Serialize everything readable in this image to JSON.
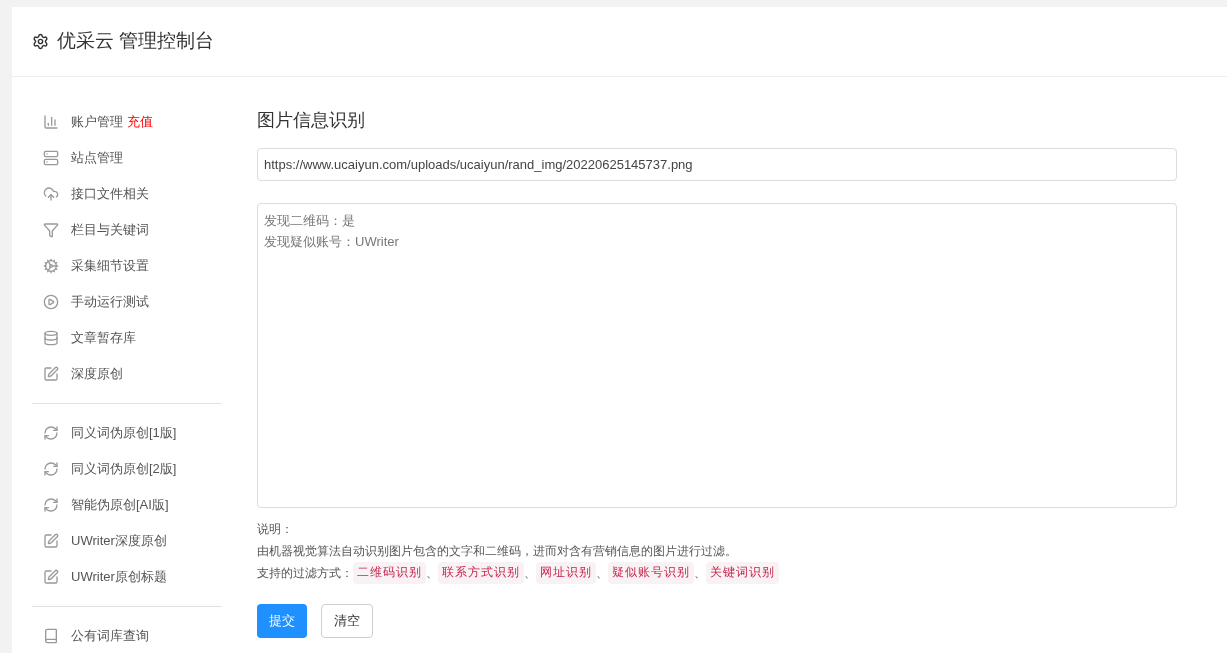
{
  "header": {
    "title": "优采云 管理控制台"
  },
  "sidebar": {
    "items": [
      {
        "kind": "chart",
        "label": "账户管理",
        "badge": "充值"
      },
      {
        "kind": "server",
        "label": "站点管理"
      },
      {
        "kind": "cloud",
        "label": "接口文件相关"
      },
      {
        "kind": "filter",
        "label": "栏目与关键词"
      },
      {
        "kind": "gears",
        "label": "采集细节设置"
      },
      {
        "kind": "play",
        "label": "手动运行测试"
      },
      {
        "kind": "database",
        "label": "文章暂存库"
      },
      {
        "kind": "edit",
        "label": "深度原创"
      },
      {
        "kind": "divider"
      },
      {
        "kind": "refresh",
        "label": "同义词伪原创[1版]"
      },
      {
        "kind": "refresh",
        "label": "同义词伪原创[2版]"
      },
      {
        "kind": "refresh",
        "label": "智能伪原创[AI版]"
      },
      {
        "kind": "edit",
        "label": "UWriter深度原创"
      },
      {
        "kind": "edit",
        "label": "UWriter原创标题"
      },
      {
        "kind": "divider"
      },
      {
        "kind": "book",
        "label": "公有词库查询"
      }
    ]
  },
  "main": {
    "title": "图片信息识别",
    "url_field": {
      "value": "https://www.ucaiyun.com/uploads/ucaiyun/rand_img/20220625145737.png"
    },
    "result": {
      "lines": [
        "发现二维码：是",
        "发现疑似账号：UWriter"
      ]
    },
    "notes": {
      "heading": "说明：",
      "description": "由机器视觉算法自动识别图片包含的文字和二维码，进而对含有营销信息的图片进行过滤。",
      "methods_label": "支持的过滤方式：",
      "separator": "、",
      "methods": [
        "二维码识别",
        "联系方式识别",
        "网址识别",
        "疑似账号识别",
        "关键词识别"
      ]
    },
    "buttons": [
      {
        "kind": "primary",
        "label": "提交"
      },
      {
        "kind": "default",
        "label": "清空"
      }
    ]
  }
}
